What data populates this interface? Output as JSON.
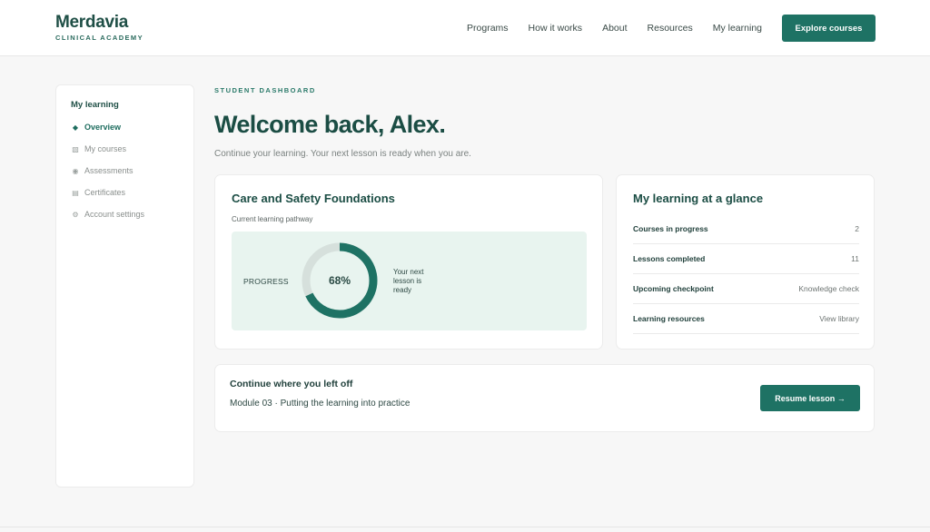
{
  "brand": {
    "name": "Merdavia",
    "subtitle": "CLINICAL ACADEMY"
  },
  "nav": {
    "links": [
      "Programs",
      "How it works",
      "About",
      "Resources",
      "My learning"
    ],
    "cta": "Explore courses"
  },
  "sidebar": {
    "title": "My learning",
    "items": [
      {
        "label": "Overview",
        "icon": "diamond-icon",
        "active": true
      },
      {
        "label": "My courses",
        "icon": "book-icon",
        "active": false
      },
      {
        "label": "Assessments",
        "icon": "circle-icon",
        "active": false
      },
      {
        "label": "Certificates",
        "icon": "certificate-icon",
        "active": false
      },
      {
        "label": "Account settings",
        "icon": "gear-icon",
        "active": false
      }
    ]
  },
  "main": {
    "eyebrow": "STUDENT DASHBOARD",
    "heading": "Welcome back, Alex.",
    "subheading": "Continue your learning. Your next lesson is ready when you are."
  },
  "course": {
    "title": "Care and Safety Foundations",
    "pathway_label": "Current learning pathway",
    "progress_label": "PROGRESS",
    "progress_percent": 68,
    "progress_text": "68%",
    "next_lesson": "Your next lesson is ready"
  },
  "glance": {
    "title": "My learning at a glance",
    "rows": [
      {
        "key": "Courses in progress",
        "value": "2"
      },
      {
        "key": "Lessons completed",
        "value": "11"
      },
      {
        "key": "Upcoming checkpoint",
        "value": "Knowledge check"
      },
      {
        "key": "Learning resources",
        "value": "View library"
      }
    ]
  },
  "continue": {
    "title": "Continue where you left off",
    "module": "Module 03 · Putting the learning into practice",
    "button": "Resume lesson →"
  },
  "colors": {
    "accent": "#1e7264",
    "heading": "#1b4d44",
    "panel": "#e8f4ef",
    "ring_track": "#d6e0dc"
  }
}
